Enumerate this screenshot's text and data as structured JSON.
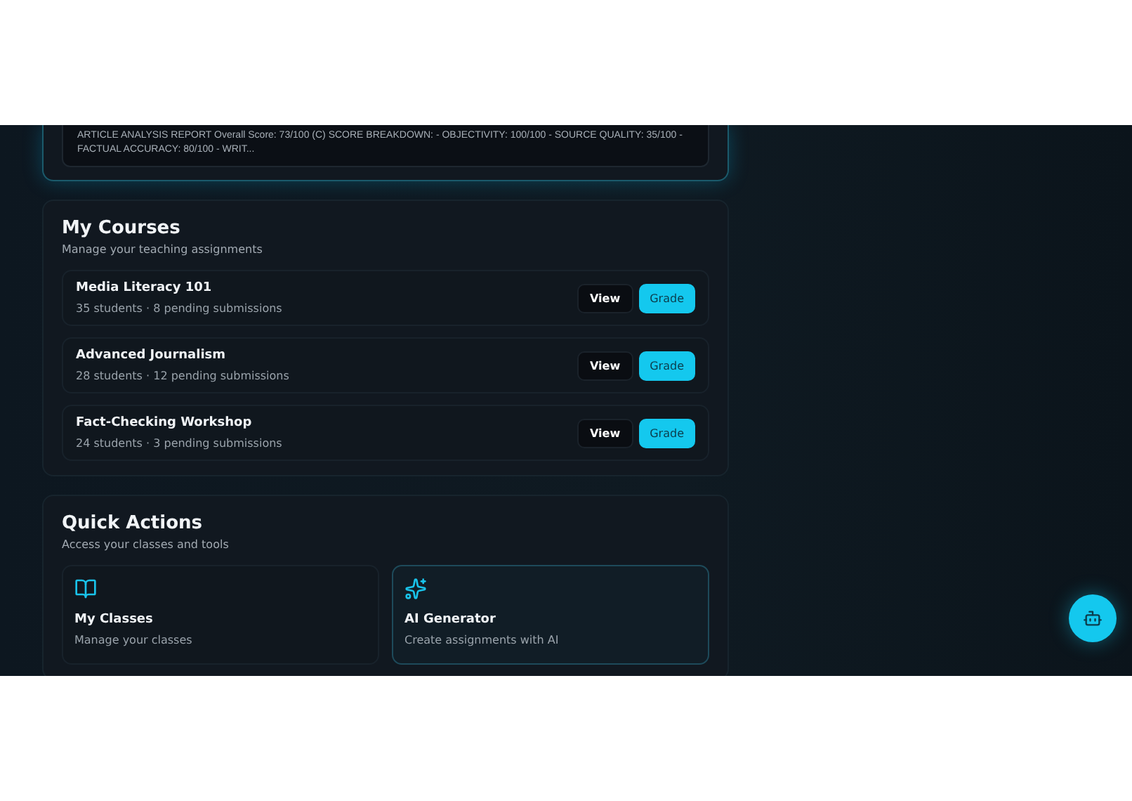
{
  "report_card": {
    "text": "ARTICLE ANALYSIS REPORT Overall Score: 73/100 (C) SCORE BREAKDOWN: - OBJECTIVITY: 100/100 - SOURCE QUALITY: 35/100 - FACTUAL ACCURACY: 80/100 - WRIT..."
  },
  "courses": {
    "title": "My Courses",
    "subtitle": "Manage your teaching assignments",
    "items": [
      {
        "name": "Media Literacy 101",
        "meta": "35 students · 8 pending submissions",
        "view": "View",
        "grade": "Grade"
      },
      {
        "name": "Advanced Journalism",
        "meta": "28 students · 12 pending submissions",
        "view": "View",
        "grade": "Grade"
      },
      {
        "name": "Fact-Checking Workshop",
        "meta": "24 students · 3 pending submissions",
        "view": "View",
        "grade": "Grade"
      }
    ]
  },
  "quick_actions": {
    "title": "Quick Actions",
    "subtitle": "Access your classes and tools",
    "items": [
      {
        "kind": "book",
        "title": "My Classes",
        "description": "Manage your classes",
        "selected": false
      },
      {
        "kind": "sparkles",
        "title": "AI Generator",
        "description": "Create assignments with AI",
        "selected": true
      }
    ]
  }
}
